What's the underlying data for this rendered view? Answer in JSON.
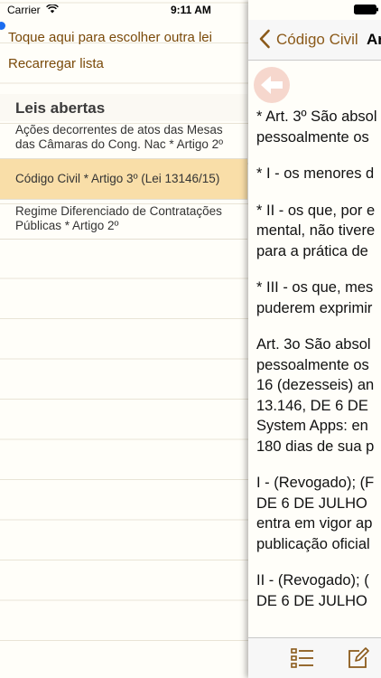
{
  "status_bar": {
    "carrier": "Carrier",
    "time": "9:11 AM"
  },
  "actions": {
    "choose_law": "Toque aqui para escolher outra lei",
    "reload_list": "Recarregar lista"
  },
  "open_laws": {
    "title": "Leis abertas",
    "items": [
      {
        "line1": "Ações decorrentes de atos das Mesas",
        "line2": "das Câmaras do Cong. Nac * Artigo 2º",
        "selected": false
      },
      {
        "line1": "Código Civil * Artigo 3º (Lei 13146/15)",
        "line2": "",
        "selected": true
      },
      {
        "line1": "Regime Diferenciado de Contratações",
        "line2": "Públicas * Artigo 2º",
        "selected": false
      }
    ]
  },
  "detail": {
    "back_label": "Código Civil",
    "title": "Art",
    "paragraphs": [
      [
        "* Art. 3º São absol",
        "pessoalmente os"
      ],
      [
        "* I - os menores d"
      ],
      [
        "* II - os que, por e",
        "mental, não tivere",
        "para a prática de"
      ],
      [
        "* III - os que, mes",
        "puderem exprimir"
      ],
      [
        "Art. 3o São absol",
        "pessoalmente os",
        "16 (dezesseis) an",
        "13.146, DE 6 DE",
        "System Apps: en",
        "180 dias de sua p"
      ],
      [
        "I - (Revogado); (F",
        "DE 6 DE JULHO",
        "entra em vigor ap",
        "publicação oficial"
      ],
      [
        "II - (Revogado); (",
        "DE 6 DE JULHO"
      ]
    ]
  },
  "toolbar": {
    "list_icon": "list-icon",
    "edit_icon": "edit-icon"
  },
  "colors": {
    "accent": "#8b5a1a",
    "selected_row": "#f9dea8",
    "back_circle": "#f6d7cd"
  }
}
